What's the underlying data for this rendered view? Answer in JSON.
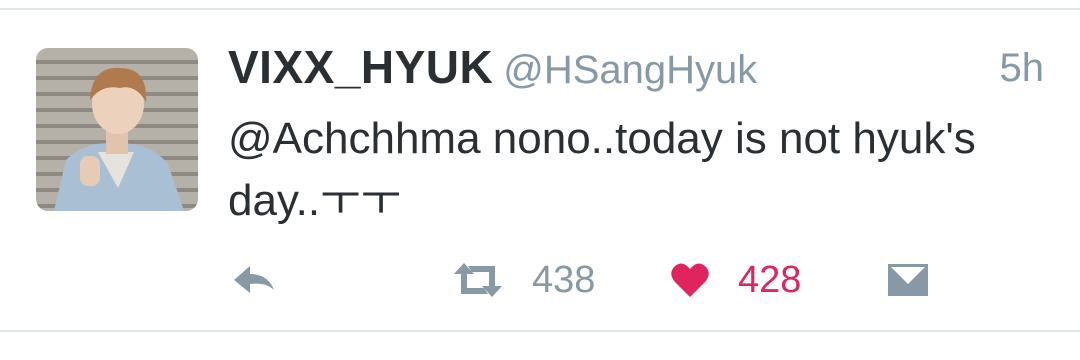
{
  "tweet": {
    "display_name": "VIXX_HYUK",
    "handle": "@HSangHyuk",
    "timestamp": "5h",
    "mention": "@Achchhma",
    "text_line1_rest": " nono..today is not hyuk's",
    "text_line2": "day..ㅜㅜ"
  },
  "actions": {
    "reply_icon": "reply-icon",
    "retweet_icon": "retweet-icon",
    "retweet_count": "438",
    "like_icon": "heart-icon",
    "like_count": "428",
    "dm_icon": "direct-message-icon"
  },
  "colors": {
    "text": "#292f33",
    "muted": "#8899a6",
    "like": "#e0245e",
    "divider": "#e1e8ed"
  }
}
